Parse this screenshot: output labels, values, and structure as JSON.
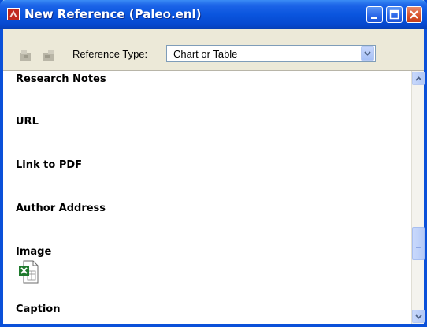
{
  "window": {
    "title": "New Reference (Paleo.enl)"
  },
  "toolbar": {
    "reference_type_label": "Reference Type:",
    "reference_type_value": "Chart or Table"
  },
  "fields": [
    {
      "label": "Research Notes"
    },
    {
      "label": "URL"
    },
    {
      "label": "Link to PDF"
    },
    {
      "label": "Author Address"
    },
    {
      "label": "Image"
    },
    {
      "label": "Caption"
    }
  ],
  "icons": {
    "app": "endnote-app-icon",
    "image_attachment": "excel-file-icon"
  },
  "colors": {
    "titlebar": "#0a55de",
    "window_bg": "#ece9d8",
    "close_button": "#d8502a"
  }
}
